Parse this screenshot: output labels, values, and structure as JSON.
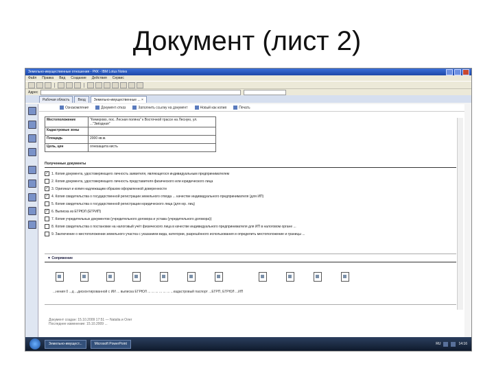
{
  "slide": {
    "title": "Документ (лист 2)"
  },
  "window": {
    "title": "Земельно-имущественные отношения - РКК - IBM Lotus Notes",
    "menu": [
      "Файл",
      "Правка",
      "Вид",
      "Создание",
      "Действия",
      "Сервис"
    ],
    "address_label": "Адрес"
  },
  "tabs": [
    {
      "label": "Рабочая область"
    },
    {
      "label": "Вход"
    },
    {
      "label": "Земельно-имущественные ... ×"
    }
  ],
  "actions": [
    {
      "label": "Ознакомление"
    },
    {
      "label": "Документ-отказ"
    },
    {
      "label": "Заполнить ссылку на документ"
    },
    {
      "label": "Новый как копия"
    },
    {
      "label": "Печать"
    }
  ],
  "info": [
    {
      "key": "Местоположение",
      "value": "\"Кемерово, пос. Лесная поляна\" к Восточной трассе на Лесную, ул. ...\"Звёздная\""
    },
    {
      "key": "Кадастровые зоны",
      "value": ""
    },
    {
      "key": "Площадь",
      "value": "2000 кв.м."
    },
    {
      "key": "Цель, цен",
      "value": "огнезащита кисть"
    }
  ],
  "docs": {
    "heading": "Полученные документы",
    "items": [
      {
        "checked": true,
        "text": "1. Копия документа, удостоверяющего личность заявителя, являющегося индивидуальным предпринимателем"
      },
      {
        "checked": false,
        "text": "2. Копия документа, удостоверяющего личность представителя физического или юридического лица"
      },
      {
        "checked": true,
        "text": "3. Оригинал и копия надлежащим образом оформленной доверенности"
      },
      {
        "checked": true,
        "text": "4. Копия свидетельства о государственной регистрации земельного отвода ... качестве индивидуального предпринимателя (для ИП)"
      },
      {
        "checked": false,
        "text": "5. Копия свидетельства о государственной регистрации юридического лица (для юр. лиц)"
      },
      {
        "checked": true,
        "text": "6. Выписка из ЕГРЮЛ (ЕГРИП)"
      },
      {
        "checked": false,
        "text": "7. Копия учредительных документов (учредительного договора и устава (учредительного договора))"
      },
      {
        "checked": false,
        "text": "8. Копия свидетельства о постановке на налоговый учёт физического лица в качестве индивидуального предпринимателя для ИП в налоговом органе ..."
      },
      {
        "checked": false,
        "text": "9. Заключение о местоположении земельного участка с указанием вида, категории, разрешённого использования и определить местоположение и границы ..."
      }
    ]
  },
  "attachments": {
    "heading": "Сопряжение",
    "caption": "...нения 0 ...д ...дисконтированной с ИИ ... выписка ЕГРЮЛ ... ... ... ... ... ... ...кадастровый паспорт ...ЕГРП, ЕГРЮЛ ...ИП"
  },
  "meta": {
    "created": "Документ создан: 15.10.2009 17:51 — Natalia и Олег",
    "modified": "Последнее изменение: 15.10.2009 ..."
  },
  "taskbar": {
    "items": [
      "Земельно-имущест...",
      "Microsoft PowerPoint"
    ],
    "lang": "RU",
    "clock": "14:16"
  }
}
